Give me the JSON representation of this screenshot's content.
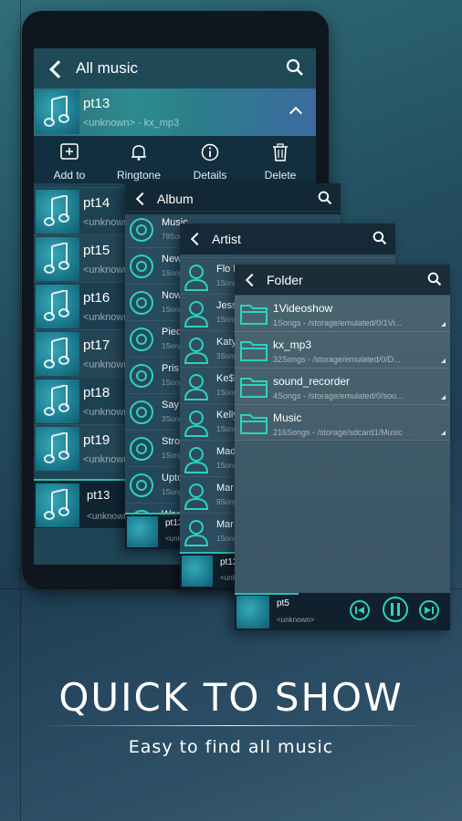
{
  "colors": {
    "accent": "#2bd3bd",
    "background": "#244f60"
  },
  "main": {
    "title": "All music",
    "expanded_track": {
      "title": "pt13",
      "subtitle": "<unknown> - kx_mp3"
    },
    "actions": [
      {
        "label": "Add to",
        "icon": "add-icon"
      },
      {
        "label": "Ringtone",
        "icon": "bell-icon"
      },
      {
        "label": "Details",
        "icon": "info-icon"
      },
      {
        "label": "Delete",
        "icon": "trash-icon"
      }
    ],
    "tracks": [
      {
        "title": "pt14",
        "subtitle": "<unknown>"
      },
      {
        "title": "pt15",
        "subtitle": "<unknown>"
      },
      {
        "title": "pt16",
        "subtitle": "<unknown>"
      },
      {
        "title": "pt17",
        "subtitle": "<unknown>"
      },
      {
        "title": "pt18",
        "subtitle": "<unknown>"
      },
      {
        "title": "pt19",
        "subtitle": "<unknown>"
      }
    ],
    "now_playing": {
      "title": "pt13",
      "subtitle": "<unknown>"
    }
  },
  "album": {
    "title": "Album",
    "items": [
      {
        "name": "Music",
        "sub": "79Songs"
      },
      {
        "name": "New",
        "sub": "1Song"
      },
      {
        "name": "Now",
        "sub": "1Song"
      },
      {
        "name": "Piec",
        "sub": "1Song"
      },
      {
        "name": "Pris",
        "sub": "1Song"
      },
      {
        "name": "Say",
        "sub": "3Song"
      },
      {
        "name": "Stro",
        "sub": "1Song"
      },
      {
        "name": "Upto",
        "sub": "1Song"
      },
      {
        "name": "War",
        "sub": ""
      }
    ],
    "now_playing": {
      "title": "pt13",
      "subtitle": "<unknown>"
    }
  },
  "artist": {
    "title": "Artist",
    "items": [
      {
        "name": "Flo R",
        "sub": "1Song"
      },
      {
        "name": "Jess",
        "sub": "1Song"
      },
      {
        "name": "Katy",
        "sub": "3Song"
      },
      {
        "name": "Ke$",
        "sub": "1Song"
      },
      {
        "name": "Kelly",
        "sub": "1Song"
      },
      {
        "name": "Mad",
        "sub": "1Song"
      },
      {
        "name": "Mar",
        "sub": "9Song"
      },
      {
        "name": "Mar",
        "sub": "1Song"
      }
    ],
    "now_playing": {
      "title": "pt13",
      "subtitle": "<unk"
    }
  },
  "folder": {
    "title": "Folder",
    "items": [
      {
        "name": "1Videoshow",
        "sub": "1Songs  -  /storage/emulated/0/1Vi..."
      },
      {
        "name": "kx_mp3",
        "sub": "32Songs  -  /storage/emulated/0/D..."
      },
      {
        "name": "sound_recorder",
        "sub": "4Songs  -  /storage/emulated/0/sou..."
      },
      {
        "name": "Music",
        "sub": "216Songs  -  /storage/sdcard1/Music"
      }
    ],
    "now_playing": {
      "title": "pt5",
      "subtitle": "<unknown>"
    }
  },
  "promo": {
    "headline": "QUICK TO SHOW",
    "subline": "Easy to find all music"
  }
}
